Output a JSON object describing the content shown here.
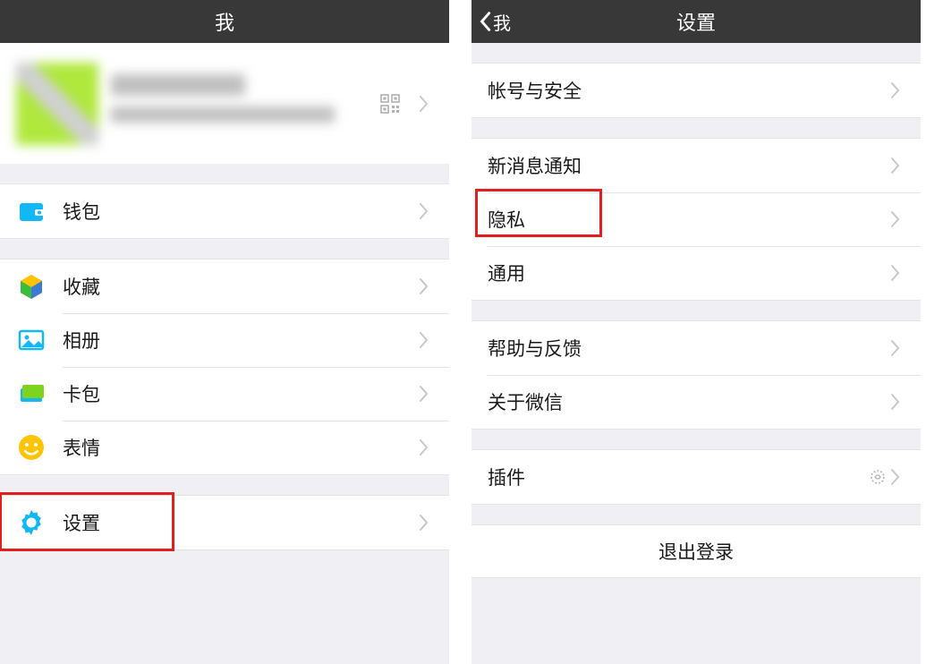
{
  "left": {
    "title": "我",
    "wallet": "钱包",
    "favorites": "收藏",
    "album": "相册",
    "cards": "卡包",
    "stickers": "表情",
    "settings": "设置"
  },
  "right": {
    "back": "我",
    "title": "设置",
    "account_security": "帐号与安全",
    "notifications": "新消息通知",
    "privacy": "隐私",
    "general": "通用",
    "help": "帮助与反馈",
    "about": "关于微信",
    "plugins": "插件",
    "logout": "退出登录"
  }
}
